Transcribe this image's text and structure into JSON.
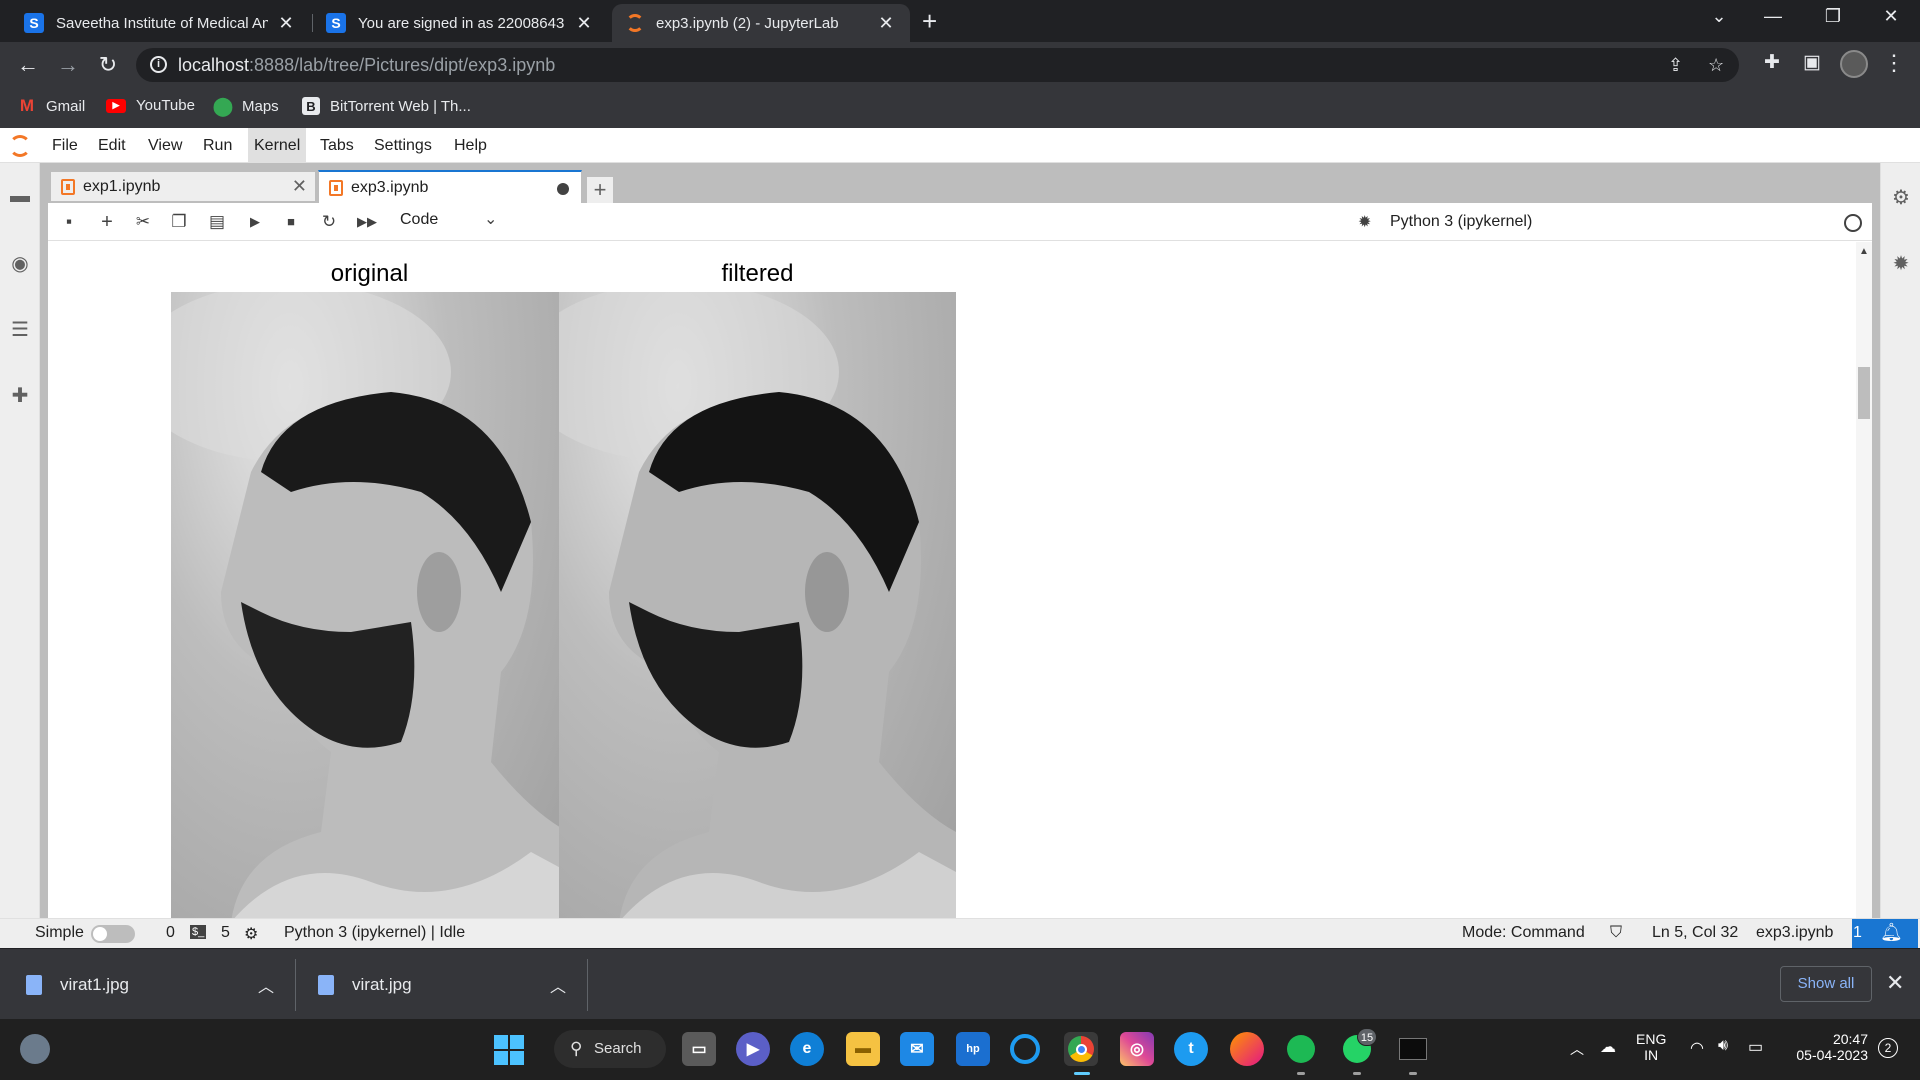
{
  "browser": {
    "tabs": [
      {
        "favicon": "S",
        "title": "Saveetha Institute of Medical And"
      },
      {
        "favicon": "S",
        "title": "You are signed in as 22008643"
      },
      {
        "favicon": "jupyter",
        "title": "exp3.ipynb (2) - JupyterLab"
      }
    ],
    "url_host": "localhost",
    "url_rest": ":8888/lab/tree/Pictures/dipt/exp3.ipynb",
    "bookmarks": [
      {
        "icon": "gmail-icon",
        "label": "Gmail"
      },
      {
        "icon": "youtube-icon",
        "label": "YouTube"
      },
      {
        "icon": "maps-icon",
        "label": "Maps"
      },
      {
        "icon": "bittorrent-icon",
        "label": "BitTorrent Web | Th..."
      }
    ]
  },
  "jupyter": {
    "menu": [
      "File",
      "Edit",
      "View",
      "Run",
      "Kernel",
      "Tabs",
      "Settings",
      "Help"
    ],
    "doc_tabs": [
      {
        "label": "exp1.ipynb"
      },
      {
        "label": "exp3.ipynb"
      }
    ],
    "cell_type": "Code",
    "kernel_name": "Python 3 (ipykernel)",
    "output": {
      "titles": [
        "original",
        "filtered"
      ]
    },
    "status": {
      "mode_label": "Simple",
      "count_a": "0",
      "terminal_icon": "$_",
      "count_b": "5",
      "kernel": "Python 3 (ipykernel) | Idle",
      "mode": "Mode: Command",
      "cursor": "Ln 5, Col 32",
      "file": "exp3.ipynb",
      "notifications": "1"
    }
  },
  "downloads": {
    "files": [
      "virat1.jpg",
      "virat.jpg"
    ],
    "show_all": "Show all"
  },
  "taskbar": {
    "search": "Search",
    "whatsapp_badge": "15",
    "lang_top": "ENG",
    "lang_bottom": "IN",
    "time": "20:47",
    "date": "05-04-2023",
    "notif_count": "2"
  }
}
